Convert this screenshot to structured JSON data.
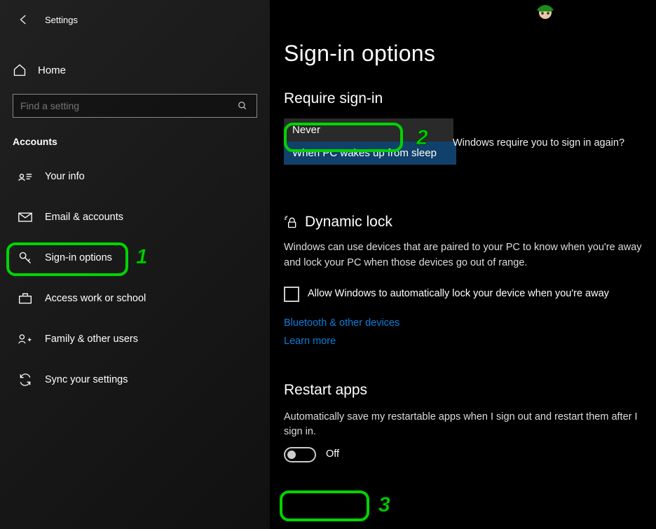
{
  "app_title": "Settings",
  "home_label": "Home",
  "search_placeholder": "Find a setting",
  "section_header": "Accounts",
  "nav": [
    {
      "label": "Your info"
    },
    {
      "label": "Email & accounts"
    },
    {
      "label": "Sign-in options"
    },
    {
      "label": "Access work or school"
    },
    {
      "label": "Family & other users"
    },
    {
      "label": "Sync your settings"
    }
  ],
  "main": {
    "title": "Sign-in options",
    "require_heading": "Require sign-in",
    "signin_question": "Windows require you to sign in again?",
    "dropdown": {
      "selected": "Never",
      "option": "When PC wakes up from sleep"
    },
    "dynamic_heading": "Dynamic lock",
    "dynamic_desc": "Windows can use devices that are paired to your PC to know when you're away and lock your PC when those devices go out of range.",
    "dynamic_checkbox": "Allow Windows to automatically lock your device when you're away",
    "link_bt": "Bluetooth & other devices",
    "link_learn": "Learn more",
    "restart_heading": "Restart apps",
    "restart_desc": "Automatically save my restartable apps when I sign out and restart them after I sign in.",
    "toggle_label": "Off"
  },
  "annotations": {
    "one": "1",
    "two": "2",
    "three": "3"
  }
}
